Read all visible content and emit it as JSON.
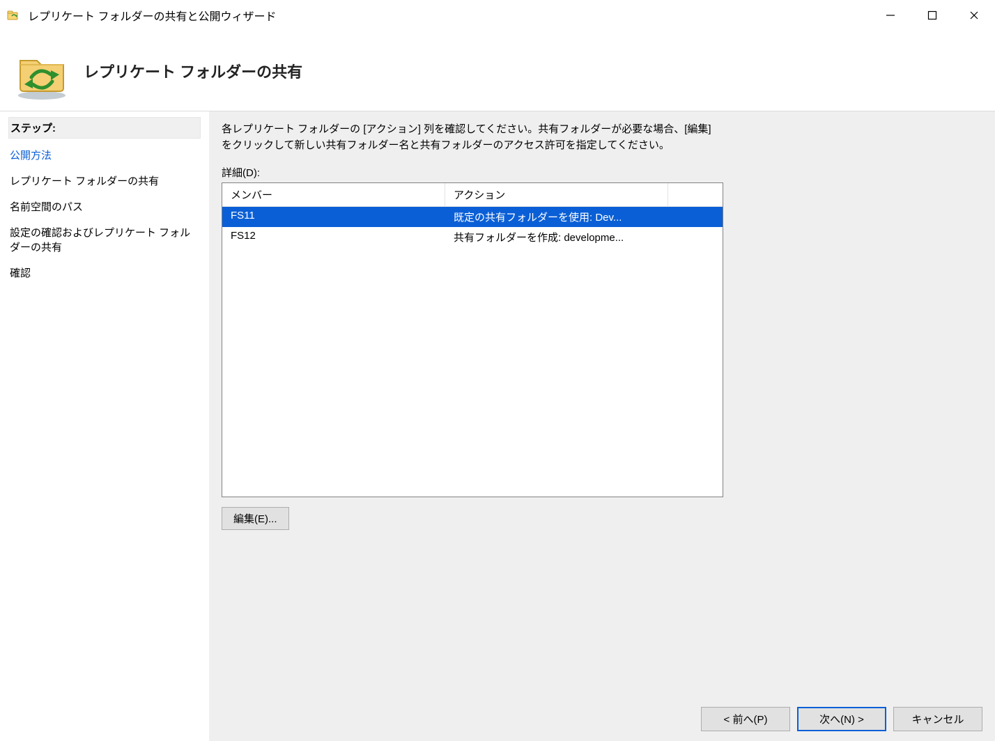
{
  "window": {
    "title": "レプリケート フォルダーの共有と公開ウィザード"
  },
  "header": {
    "title": "レプリケート フォルダーの共有"
  },
  "sidebar": {
    "heading": "ステップ:",
    "steps": [
      {
        "label": "公開方法",
        "active": true
      },
      {
        "label": "レプリケート フォルダーの共有",
        "active": false
      },
      {
        "label": "名前空間のパス",
        "active": false
      },
      {
        "label": "設定の確認およびレプリケート フォルダーの共有",
        "active": false
      },
      {
        "label": "確認",
        "active": false
      }
    ]
  },
  "main": {
    "instruction": "各レプリケート フォルダーの [アクション] 列を確認してください。共有フォルダーが必要な場合、[編集] をクリックして新しい共有フォルダー名と共有フォルダーのアクセス許可を指定してください。",
    "detail_label": "詳細(D):",
    "columns": {
      "c1": "メンバー",
      "c2": "アクション"
    },
    "rows": [
      {
        "member": "FS11",
        "action": "既定の共有フォルダーを使用: Dev...",
        "selected": true
      },
      {
        "member": "FS12",
        "action": "共有フォルダーを作成: developme...",
        "selected": false
      }
    ],
    "edit_button": "編集(E)..."
  },
  "footer": {
    "back": "< 前へ(P)",
    "next": "次へ(N) >",
    "cancel": "キャンセル"
  }
}
